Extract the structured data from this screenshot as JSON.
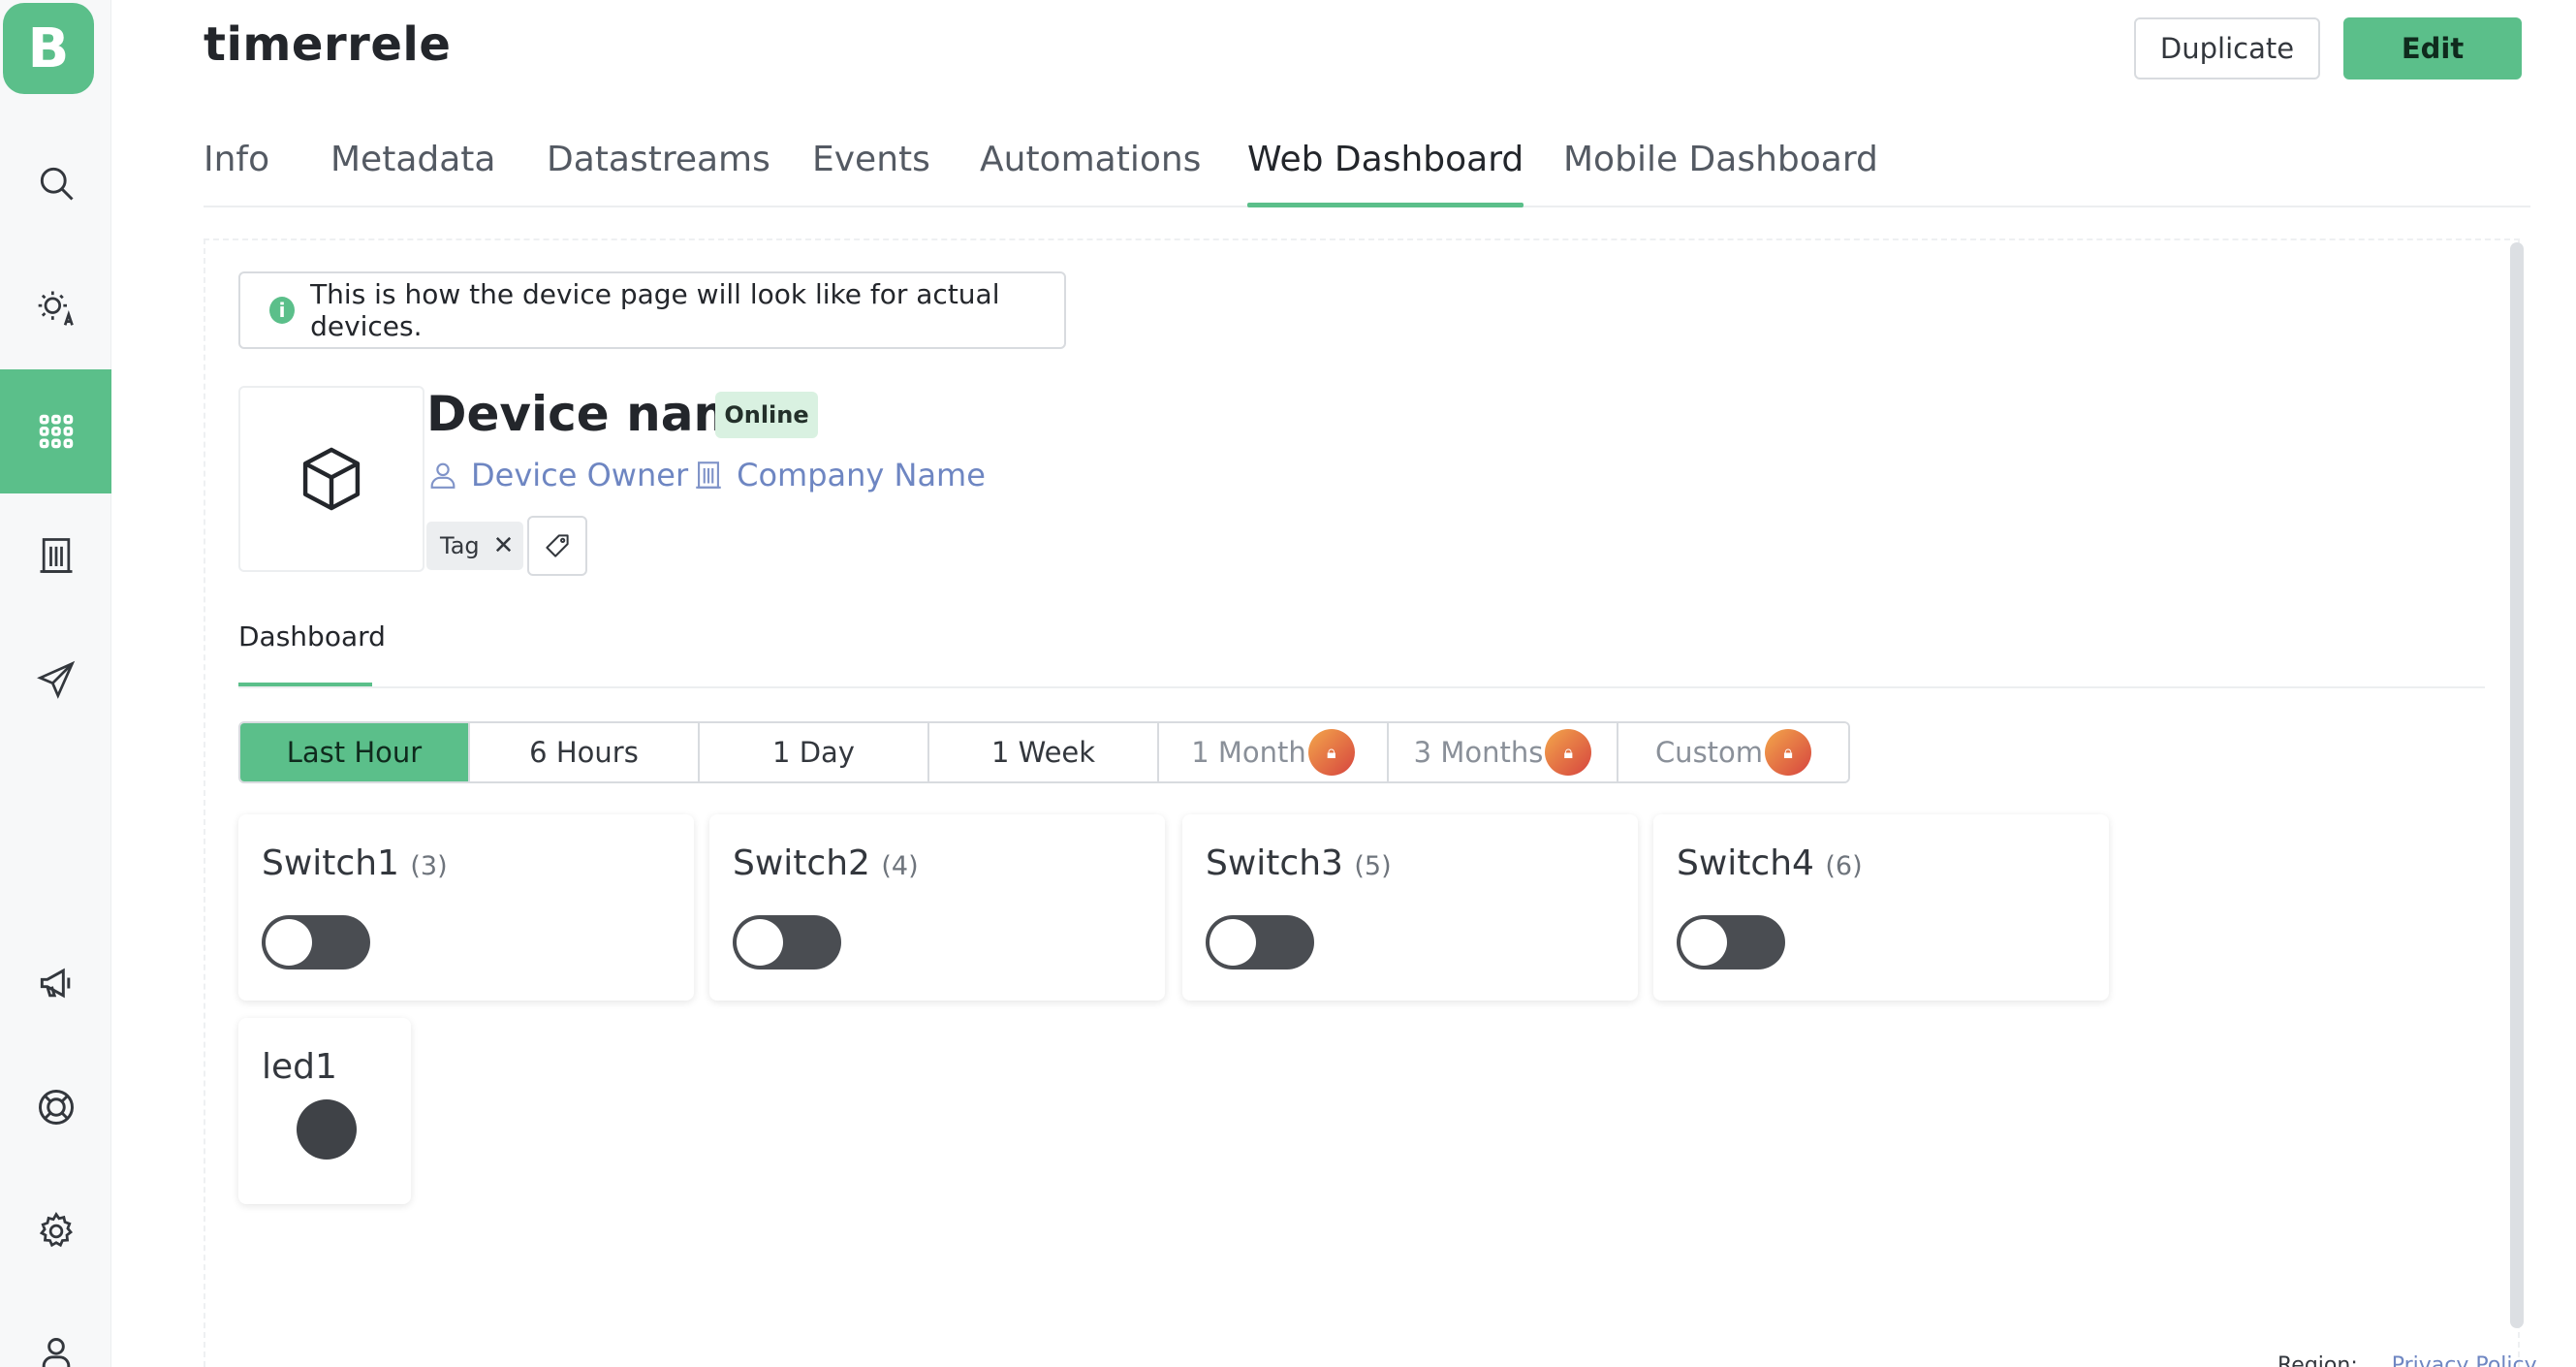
{
  "app": {
    "logo_letter": "B",
    "accent": "#5bbf8a"
  },
  "sidebar": {
    "items": [
      {
        "icon": "search-icon",
        "active": false
      },
      {
        "icon": "sun-icon",
        "active": false
      },
      {
        "icon": "grid-icon",
        "active": true
      },
      {
        "icon": "building-icon",
        "active": false
      },
      {
        "icon": "send-icon",
        "active": false
      },
      {
        "icon": "megaphone-icon",
        "active": false
      },
      {
        "icon": "lifebuoy-icon",
        "active": false
      },
      {
        "icon": "gear-icon",
        "active": false
      },
      {
        "icon": "user-icon",
        "active": false
      }
    ]
  },
  "header": {
    "title": "timerrele",
    "duplicate_label": "Duplicate",
    "edit_label": "Edit"
  },
  "tabs": [
    {
      "label": "Info"
    },
    {
      "label": "Metadata"
    },
    {
      "label": "Datastreams"
    },
    {
      "label": "Events"
    },
    {
      "label": "Automations"
    },
    {
      "label": "Web Dashboard",
      "active": true
    },
    {
      "label": "Mobile Dashboard"
    }
  ],
  "info_banner": {
    "icon": "info-icon",
    "text": "This is how the device page will look like for actual devices."
  },
  "device": {
    "name": "Device name",
    "status": "Online",
    "owner": "Device Owner",
    "company": "Company Name",
    "tag": "Tag"
  },
  "dashboard_tab": "Dashboard",
  "time_ranges": [
    {
      "label": "Last Hour",
      "active": true,
      "locked": false
    },
    {
      "label": "6 Hours",
      "active": false,
      "locked": false
    },
    {
      "label": "1 Day",
      "active": false,
      "locked": false
    },
    {
      "label": "1 Week",
      "active": false,
      "locked": false
    },
    {
      "label": "1 Month",
      "active": false,
      "locked": true
    },
    {
      "label": "3 Months",
      "active": false,
      "locked": true
    },
    {
      "label": "Custom",
      "active": false,
      "locked": true
    }
  ],
  "widgets": [
    {
      "type": "switch",
      "title": "Switch1",
      "pin": "(3)",
      "on": false
    },
    {
      "type": "switch",
      "title": "Switch2",
      "pin": "(4)",
      "on": false
    },
    {
      "type": "switch",
      "title": "Switch3",
      "pin": "(5)",
      "on": false
    },
    {
      "type": "switch",
      "title": "Switch4",
      "pin": "(6)",
      "on": false
    },
    {
      "type": "led",
      "title": "led1",
      "on": false
    }
  ],
  "footer": {
    "text": "Region: ...",
    "link": "Privacy Policy"
  }
}
